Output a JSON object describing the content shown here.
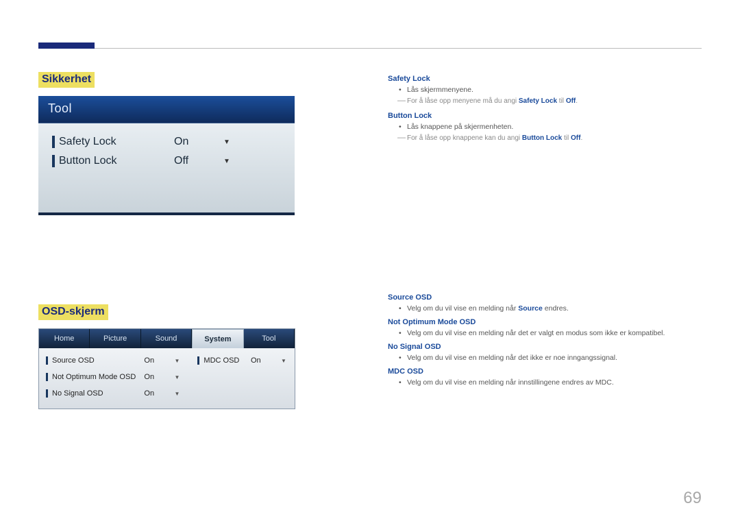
{
  "page_number": "69",
  "section1": {
    "heading": "Sikkerhet",
    "panel": {
      "title": "Tool",
      "rows": [
        {
          "label": "Safety Lock",
          "value": "On"
        },
        {
          "label": "Button Lock",
          "value": "Off"
        }
      ]
    },
    "right": {
      "items": [
        {
          "heading": "Safety Lock",
          "bullet": "Lås skjermmenyene.",
          "note_prefix": "For å låse opp menyene må du angi ",
          "note_bold1": "Safety Lock",
          "note_mid": " til ",
          "note_bold2": "Off",
          "note_suffix": "."
        },
        {
          "heading": "Button Lock",
          "bullet": "Lås knappene på skjermenheten.",
          "note_prefix": "For å låse opp knappene kan du angi ",
          "note_bold1": "Button Lock",
          "note_mid": " til ",
          "note_bold2": "Off",
          "note_suffix": "."
        }
      ]
    }
  },
  "section2": {
    "heading": "OSD-skjerm",
    "panel": {
      "tabs": [
        "Home",
        "Picture",
        "Sound",
        "System",
        "Tool"
      ],
      "active_tab": "System",
      "left_rows": [
        {
          "label": "Source OSD",
          "value": "On"
        },
        {
          "label": "Not Optimum Mode OSD",
          "value": "On"
        },
        {
          "label": "No Signal OSD",
          "value": "On"
        }
      ],
      "right_rows": [
        {
          "label": "MDC OSD",
          "value": "On"
        }
      ]
    },
    "right": {
      "items": [
        {
          "heading": "Source OSD",
          "bullet_prefix": "Velg om du vil vise en melding når ",
          "bullet_bold": "Source",
          "bullet_suffix": " endres."
        },
        {
          "heading": "Not Optimum Mode OSD",
          "bullet": "Velg om du vil vise en melding når det er valgt en modus som ikke er kompatibel."
        },
        {
          "heading": "No Signal OSD",
          "bullet": "Velg om du vil vise en melding når det ikke er noe inngangssignal."
        },
        {
          "heading": "MDC OSD",
          "bullet": "Velg om du vil vise en melding når innstillingene endres av MDC."
        }
      ]
    }
  }
}
